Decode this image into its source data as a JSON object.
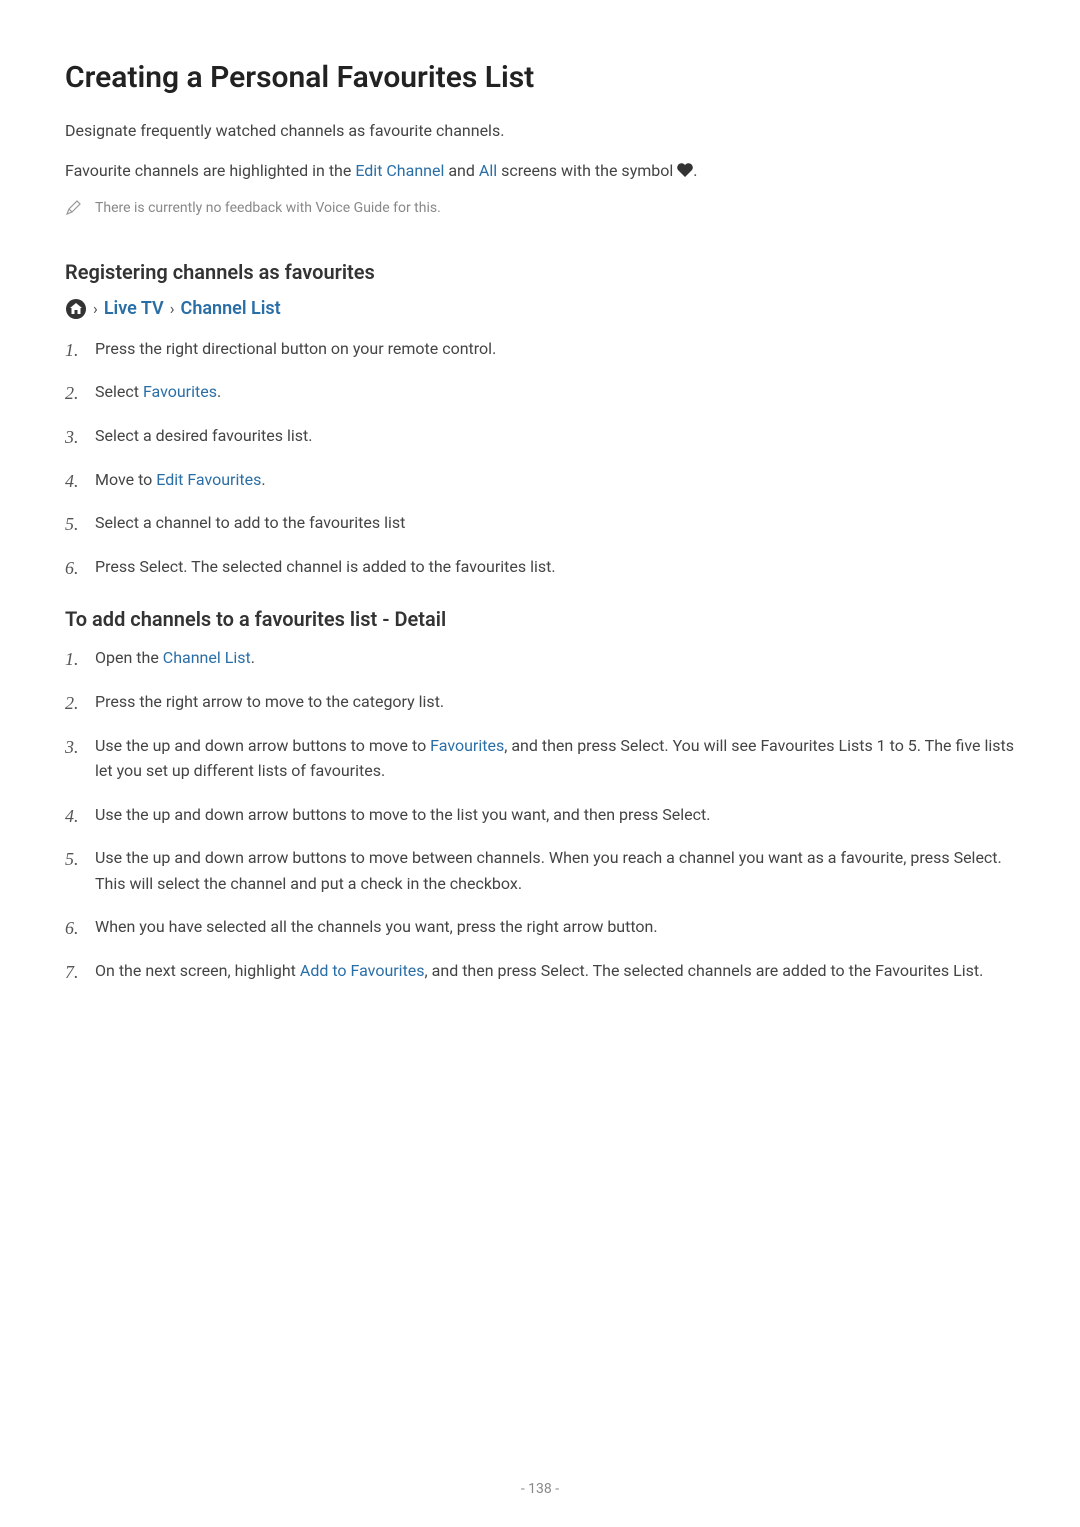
{
  "title": "Creating a Personal Favourites List",
  "intro1": "Designate frequently watched channels as favourite channels.",
  "intro2_prefix": "Favourite channels are highlighted in the ",
  "intro2_link1": "Edit Channel",
  "intro2_mid": " and ",
  "intro2_link2": "All",
  "intro2_suffix": " screens with the symbol ",
  "intro2_end": ".",
  "note_text": "There is currently no feedback with Voice Guide for this.",
  "section1_heading": "Registering channels as favourites",
  "breadcrumb": {
    "item1": "Live TV",
    "item2": "Channel List"
  },
  "section1_items": {
    "i1": "Press the right directional button on your remote control.",
    "i2_prefix": "Select ",
    "i2_link": "Favourites",
    "i2_suffix": ".",
    "i3": "Select a desired favourites list.",
    "i4_prefix": "Move to ",
    "i4_link": "Edit Favourites",
    "i4_suffix": ".",
    "i5": "Select a channel to add to the favourites list",
    "i6": "Press Select. The selected channel is added to the favourites list."
  },
  "section2_heading": "To add channels to a favourites list - Detail",
  "section2_items": {
    "i1_prefix": "Open the ",
    "i1_link": "Channel List",
    "i1_suffix": ".",
    "i2": "Press the right arrow to move to the category list.",
    "i3_prefix": "Use the up and down arrow buttons to move to ",
    "i3_link": "Favourites",
    "i3_suffix": ", and then press Select. You will see Favourites Lists 1 to 5. The five lists let you set up different lists of favourites.",
    "i4": "Use the up and down arrow buttons to move to the list you want, and then press Select.",
    "i5": "Use the up and down arrow buttons to move between channels. When you reach a channel you want as a favourite, press Select. This will select the channel and put a check in the checkbox.",
    "i6": "When you have selected all the channels you want, press the right arrow button.",
    "i7_prefix": "On the next screen, highlight ",
    "i7_link": "Add to Favourites",
    "i7_suffix": ", and then press Select. The selected channels are added to the Favourites List."
  },
  "page_number": "- 138 -"
}
